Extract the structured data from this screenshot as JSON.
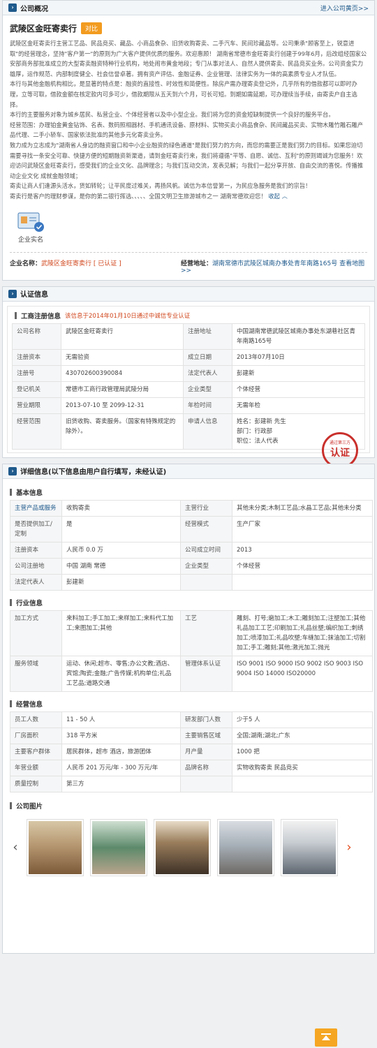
{
  "overview": {
    "title": "公司概况",
    "enter_link": "进入公司黄页>>",
    "company_name": "武陵区金旺寄卖行",
    "contrast_btn": "对比",
    "paragraphs": [
      "武陵区金旺寄卖行主营工艺品、民品竞买、藏品、小商品食杂、旧货收购寄卖、二手汽车、民间珍藏品等。公司秉承\"顾客至上，锐意进取\"的经营理念，坚持\"客户第一\"的原则为广大客户提供优质的服务。欢迎惠顾！     湖南省常德市金旺寄卖行创建于99年6月，后改组经国家公安部商务部批准成立的大型寄卖融资特种行业机构，地处闹市黄金地段；专门从事对法人、自然人提供寄卖、民品竞买业务。公司资金实力雄厚，运作规范、内部制度健全、社会信誉卓著。拥有资产评估、金融证券、企业管理、法律实务为一体的高素质专业人才队伍。",
      "本行与其他金融机构相比，是显著的特点是：融资的直接性、时效性和简便性。除房产需办理寄卖登记外，几乎所有的借款都可以即时办理，立等可取，借款金额在核定款内可多可少，借款期限从五天到六个月，可长可短。到期如需延期，可办理续当手续，由寄卖户自主选择。",
      "本行的主要服务对象为城乡居民、私营企业、个体经营者以及中小型企业。我们将为您的资金短缺制提供一个良好的服务平台。",
      "经营范围：办理铂金黄金钻饰、名表、数码照相器材、手机通讯设备、原材料、实物买卖小商品食杂、民间藏品买卖、实物木雕竹雕石雕产品代理、二手小轿车、国家依法批准的其他多元化寄卖业务。",
      "致力成为立志成为\"湖南省人身边的融资窗口和中小企业融资的绿色通道\"是我们努力的方向，而您的需要正是我们努力的目标。如果您迫切需要寻找一条安全可靠、快捷方便的短期融资新渠道，请到金旺寄卖行来，我们将遵循\"平等、自愿、诚信、互利\"的原则竭诚为您服务！欢迎访问武陵区金旺寄卖行，感受我们的企业文化、品牌理念；与我们互动交流，发表见解；与我们一起分享开放、自由交流的喜悦。传播推动企业文化 成就金融领域；",
      "寄卖让商人们逢源头活水，货如转轮；让平民度过难关，再扬风帆。诚信为本信誉第一，为民应急服务是我们的宗旨！",
      "寄卖行是客户的理财参谋，是你的第二银行挥选、、、、、全国文明卫生旅游城市之一     湖南常德欢迎您！"
    ],
    "collapse_link": "收起 ︿",
    "auth_label": "企业实名",
    "name_label": "企业名称：",
    "name_value": "武陵区金旺寄卖行",
    "certified_tag": "[ 已认证 ]",
    "addr_label": "经营地址：",
    "addr_value": "湖南常德市武陵区城南办事处青年南路165号",
    "map_link": "查看地图>>"
  },
  "cert": {
    "title": "认证信息",
    "sub_title": "工商注册信息",
    "notice": "该信息于2014年01月10日通过中诚信专业认证",
    "rows": [
      [
        "公司名称",
        "武陵区金旺寄卖行",
        "注册地址",
        "中国湖南常德武陵区城南办事处东湖巷社区青年南路165号"
      ],
      [
        "注册资本",
        "无需验资",
        "成立日期",
        "2013年07月10日"
      ],
      [
        "注册号",
        "430702600390084",
        "法定代表人",
        "彭建新"
      ],
      [
        "登记机关",
        "常德市工商行政管理局武陵分局",
        "企业类型",
        "个体经营"
      ],
      [
        "营业期限",
        "2013-07-10 至 2099-12-31",
        "年检时间",
        "无需年检"
      ],
      [
        "经营范围",
        "旧货收购、寄卖服务。（国家有特殊规定的除外）。",
        "申请人信息",
        "姓名：彭建新 先生\n部门：行政部\n职位：法人代表"
      ]
    ],
    "seal_small": "通过第三方",
    "seal_big": "认证"
  },
  "detail": {
    "title": "详细信息(以下信息由用户自行填写，未经认证)",
    "basic_title": "基本信息",
    "basic_rows": [
      [
        "主营产品或服务",
        "收购寄卖",
        "主营行业",
        "其他未分类;木制工艺品;水晶工艺品;其他未分类"
      ],
      [
        "是否提供加工/定制",
        "是",
        "经营模式",
        "生产厂家"
      ],
      [
        "注册资本",
        "人民币 0.0 万",
        "公司成立时间",
        "2013"
      ],
      [
        "公司注册地",
        "中国 湖南 常德",
        "企业类型",
        "个体经营"
      ],
      [
        "法定代表人",
        "彭建新",
        "",
        ""
      ]
    ],
    "industry_title": "行业信息",
    "industry_rows": [
      [
        "加工方式",
        "来料加工;手工加工;来样加工;来料代工加工;来图加工;其他",
        "工艺",
        "雕刻、打号;磨加工;木工;雕刻加工;注塑加工;其他礼品加工工艺;印刷加工;礼品丝塑;编织加工;刺绣加工;喷漆加工;礼品吹塑;车缝加工;抹油加工;切割加工;手工;雕刻;其他;激光加工;抛光"
      ],
      [
        "服务领域",
        "运动、休闲;超市、零售;办公文教;酒店、宾馆;陶瓷;金融;广告传媒;机构单位;礼品工艺品;道路交通",
        "管理体系认证",
        "ISO 9001 ISO 9000 ISO 9002 ISO 9003 ISO 9004 ISO 14000 ISO20000"
      ]
    ],
    "biz_title": "经营信息",
    "biz_rows": [
      [
        "员工人数",
        "11 - 50 人",
        "研发部门人数",
        "少于5 人"
      ],
      [
        "厂房面积",
        "318 平方米",
        "主要销售区域",
        "全国;湖南;湖北;广东"
      ],
      [
        "主要客户群体",
        "居民群体，超市 酒店，旅游团体",
        "月产量",
        "1000 把"
      ],
      [
        "年营业额",
        "人民币 201 万元/年 - 300 万元/年",
        "品牌名称",
        "实物收购寄卖 民品竞买"
      ],
      [
        "质量控制",
        "第三方",
        "",
        ""
      ]
    ],
    "photos_title": "公司图片"
  }
}
